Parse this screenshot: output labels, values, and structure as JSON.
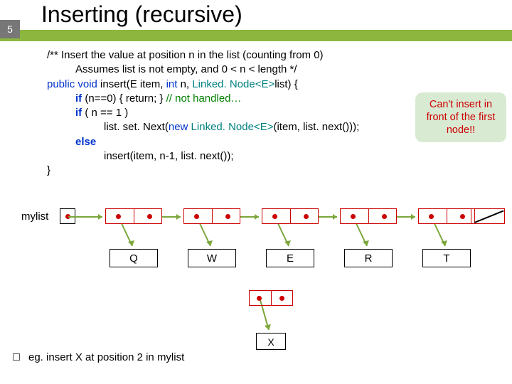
{
  "page_number": "5",
  "title": "Inserting (recursive)",
  "code": {
    "c1a": "/** Insert the value at position n in the list (counting from 0)",
    "c1b": "Assumes list is not empty, and 0 < n < length */",
    "c2_kw1": "public void",
    "c2_name": " insert",
    "c2_rest1": "(E item, ",
    "c2_kw2": "int",
    "c2_rest2": " n, ",
    "c2_type": "Linked. Node<E>",
    "c2_rest3": "list) {",
    "c3_kw": "if ",
    "c3_rest": "(n==0) { return; }    ",
    "c3_comment": "// not handled…",
    "c4_kw": "if ",
    "c4_rest": "( n == 1 )",
    "c5a": "list. set. Next(",
    "c5_kw": "new ",
    "c5_type": "Linked. Node<E>",
    "c5b": "(item, list. next()));",
    "c6_kw": "else",
    "c7": "insert(item, n-1, list. next());",
    "c8": "}"
  },
  "callout": "Can't insert in front of the first node!!",
  "diagram": {
    "label": "mylist",
    "vals": [
      "Q",
      "W",
      "E",
      "R",
      "T"
    ],
    "xval": "X"
  },
  "caption": "eg. insert X at position 2 in mylist"
}
